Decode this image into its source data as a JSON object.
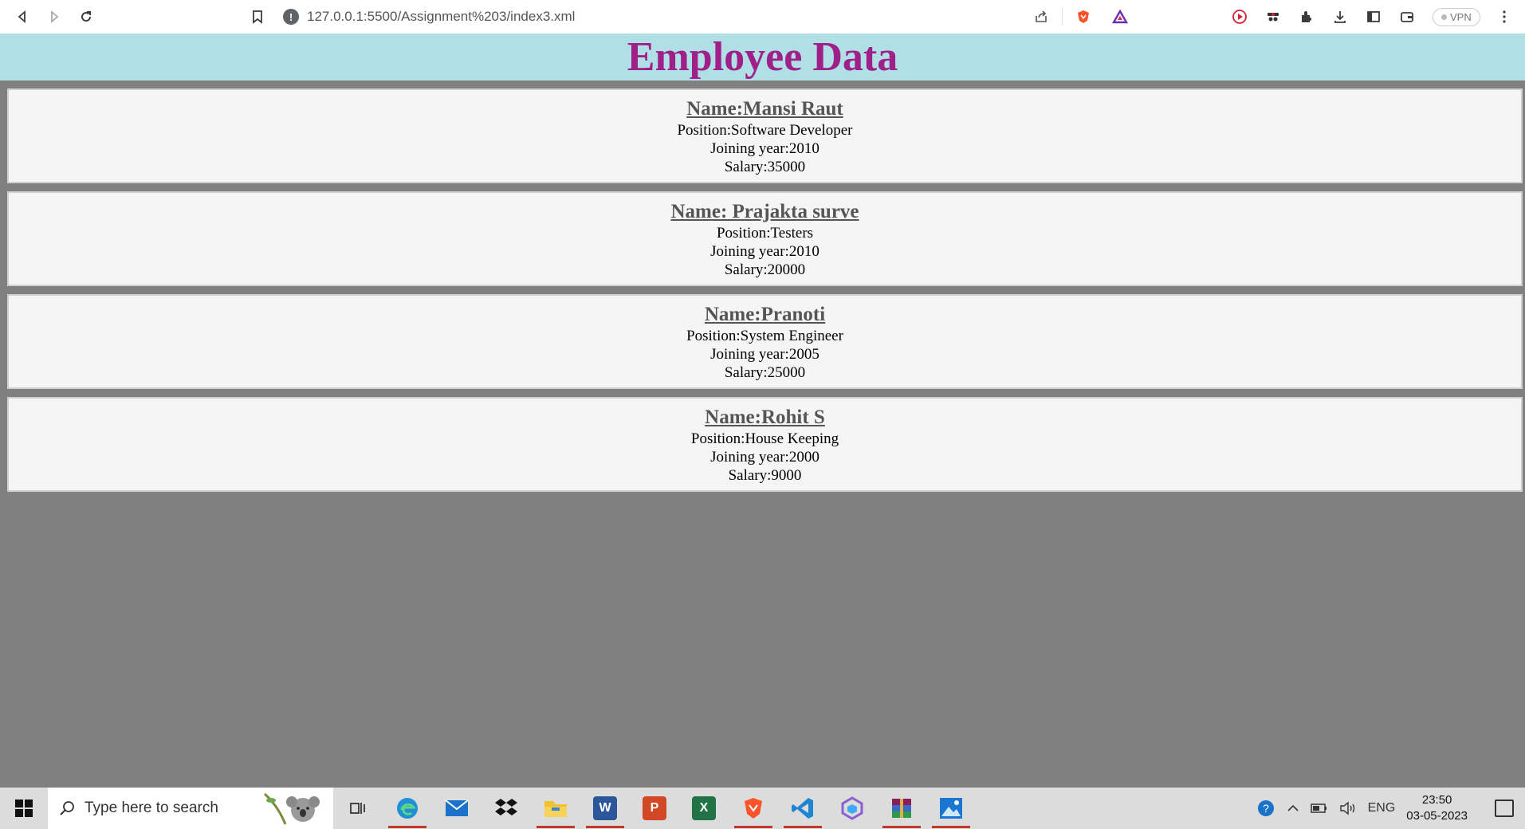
{
  "browser": {
    "url": "127.0.0.1:5500/Assignment%203/index3.xml",
    "vpn_label": "VPN"
  },
  "page": {
    "title": "Employee Data",
    "employees": [
      {
        "name": "Name:Mansi Raut",
        "position": "Position:Software Developer",
        "joining": "Joining year:2010",
        "salary": "Salary:35000"
      },
      {
        "name": "Name: Prajakta surve",
        "position": "Position:Testers",
        "joining": "Joining year:2010",
        "salary": "Salary:20000"
      },
      {
        "name": "Name:Pranoti",
        "position": "Position:System Engineer",
        "joining": "Joining year:2005",
        "salary": "Salary:25000"
      },
      {
        "name": "Name:Rohit S",
        "position": "Position:House Keeping",
        "joining": "Joining year:2000",
        "salary": "Salary:9000"
      }
    ]
  },
  "taskbar": {
    "search_placeholder": "Type here to search",
    "language": "ENG",
    "time": "23:50",
    "date": "03-05-2023"
  },
  "colors": {
    "header_bg": "#b0e0e6",
    "title_color": "#a0208a",
    "page_bg": "#808080",
    "card_bg": "#f5f5f5"
  }
}
